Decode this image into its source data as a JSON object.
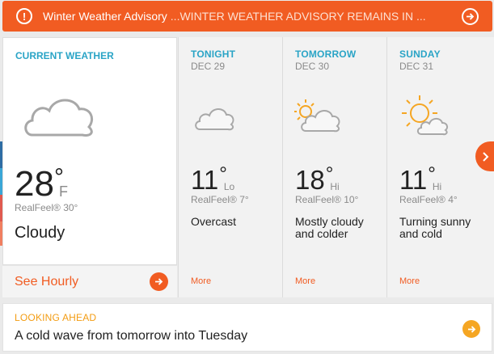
{
  "advisory": {
    "title": "Winter Weather Advisory",
    "text": "...WINTER WEATHER ADVISORY REMAINS IN ...",
    "icon": "exclamation-icon",
    "arrow_icon": "arrow-right-icon"
  },
  "current": {
    "header": "CURRENT WEATHER",
    "temp": "28",
    "degree": "°",
    "unit": "F",
    "realfeel": "RealFeel® 30°",
    "condition": "Cloudy",
    "icon": "cloud-icon",
    "see_hourly": "See Hourly"
  },
  "days": [
    {
      "header": "TONIGHT",
      "date": "DEC 29",
      "temp": "11",
      "degree": "°",
      "hilo": "Lo",
      "realfeel": "RealFeel® 7°",
      "desc": "Overcast",
      "more": "More",
      "icon": "cloud-icon"
    },
    {
      "header": "TOMORROW",
      "date": "DEC 30",
      "temp": "18",
      "degree": "°",
      "hilo": "Hi",
      "realfeel": "RealFeel® 10°",
      "desc": "Mostly cloudy and colder",
      "more": "More",
      "icon": "sun-cloud-icon"
    },
    {
      "header": "SUNDAY",
      "date": "DEC 31",
      "temp": "11",
      "degree": "°",
      "hilo": "Hi",
      "realfeel": "RealFeel® 4°",
      "desc": "Turning sunny and cold",
      "more": "More",
      "icon": "sun-cloud-icon"
    }
  ],
  "looking_ahead": {
    "label": "LOOKING AHEAD",
    "text": "A cold wave from tomorrow into Tuesday"
  },
  "colors": {
    "accent": "#f15c22",
    "header_blue": "#2aa4c6",
    "ahead_label": "#f39c12",
    "sun": "#f5a623"
  }
}
